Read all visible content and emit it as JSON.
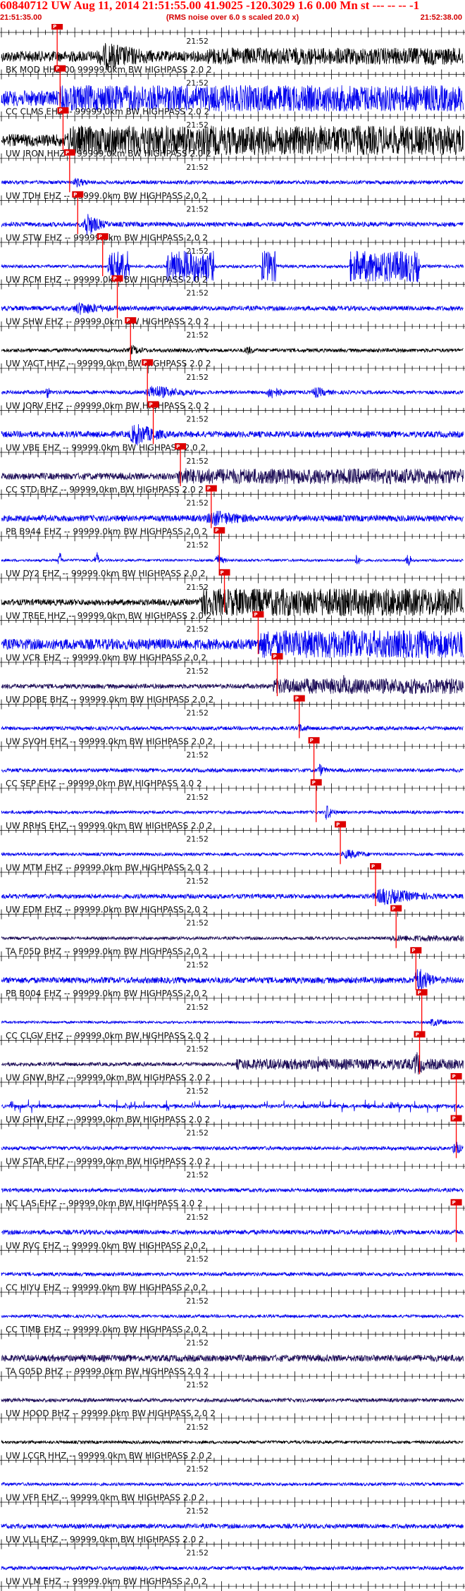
{
  "header": {
    "title": "60840712 UW Aug 11, 2014 21:51:55.00   41.9025 -120.3029  1.6 0.00 Mn st --- -- --  -1",
    "start_time": "21:51:35.00",
    "note": "(RMS noise over 6.0 s scaled 20.0 x)",
    "end_time": "21:52:38.00"
  },
  "colors": {
    "title": "#ff0000",
    "black": "#000000",
    "blue": "#0000ee",
    "navy": "#1a0a55",
    "pick": "#ff0000",
    "pick_box": "#dd0000"
  },
  "chart_data": {
    "type": "seismogram record section",
    "x_unit": "seconds after 21:51:35.00",
    "xlim": [
      0,
      63
    ],
    "minute_label": "21:52",
    "minute_label_time": 25,
    "tick_every_s": 1,
    "major_tick_every_s": 5,
    "traces": [
      {
        "label": "BK MOD HHZ 00 99999.0km BW  HIGHPASS  2.0  2",
        "color": "black",
        "pick": 7.6,
        "level": 0.35,
        "events": [
          [
            12,
            28,
            0.95,
            "burst"
          ],
          [
            28,
            63,
            0.55,
            "noise"
          ]
        ]
      },
      {
        "label": "CC CLMS EHZ -- 99999.0km BW  HIGHPASS  2.0  2",
        "color": "blue",
        "pick": 8.0,
        "level": 0.5,
        "events": [
          [
            8,
            63,
            0.85,
            "saturated"
          ]
        ]
      },
      {
        "label": "UW IRON HHZ -- 99999.0km BW  HIGHPASS  2.0  2",
        "color": "black",
        "pick": 8.4,
        "level": 0.4,
        "events": [
          [
            9,
            63,
            0.95,
            "saturated"
          ]
        ]
      },
      {
        "label": "UW TDH EHZ -- 99999.0km BW  HIGHPASS  2.0  2",
        "color": "blue",
        "pick": 9.3,
        "level": 0.12,
        "events": [
          [
            9.5,
            14,
            0.35,
            "burst"
          ]
        ]
      },
      {
        "label": "UW STW EHZ -- 99999.0km BW  HIGHPASS  2.0  2",
        "color": "blue",
        "pick": 10.4,
        "level": 0.15,
        "events": [
          [
            11,
            15,
            0.9,
            "burst"
          ]
        ]
      },
      {
        "label": "UW RCM EHZ -- 99999.0km BW  HIGHPASS  2.0  2",
        "color": "blue",
        "pick": 13.8,
        "level": 0.1,
        "events": [
          [
            14.5,
            17.5,
            1.0,
            "clip"
          ],
          [
            22.5,
            29,
            1.0,
            "clip"
          ],
          [
            35.5,
            37.5,
            1.0,
            "clip"
          ],
          [
            47.5,
            57,
            1.0,
            "clip"
          ]
        ]
      },
      {
        "label": "UW SHW EHZ -- 99999.0km BW  HIGHPASS  2.0  2",
        "color": "blue",
        "pick": 15.8,
        "level": 0.15,
        "events": [
          [
            9,
            20,
            0.45,
            "burst"
          ]
        ]
      },
      {
        "label": "UW YACT HHZ -- 99999.0km BW  HIGHPASS  2.0  2",
        "color": "black",
        "pick": 17.6,
        "level": 0.12,
        "events": [
          [
            17,
            22,
            0.35,
            "burst"
          ],
          [
            33,
            36,
            0.35,
            "burst"
          ]
        ]
      },
      {
        "label": "UW JORV EHZ -- 99999.0km BW  HIGHPASS  2.0  2",
        "color": "blue",
        "pick": 19.9,
        "level": 0.12,
        "events": [
          [
            6,
            7,
            0.6,
            "burst"
          ],
          [
            19,
            30,
            0.5,
            "burst"
          ],
          [
            36,
            40,
            0.5,
            "burst"
          ],
          [
            42,
            47,
            0.4,
            "burst"
          ]
        ]
      },
      {
        "label": "UW VBE EHZ -- 99999.0km BW  HIGHPASS  2.0  2",
        "color": "blue",
        "pick": 20.7,
        "level": 0.2,
        "events": [
          [
            17,
            25,
            0.8,
            "burst"
          ]
        ]
      },
      {
        "label": "CC STD BHZ -- 99999.0km BW  HIGHPASS  2.0  2",
        "color": "navy",
        "pick": 24.4,
        "level": 0.22,
        "events": [
          [
            24,
            63,
            0.5,
            "noise"
          ],
          [
            25,
            26,
            0.95,
            "burst"
          ]
        ]
      },
      {
        "label": "PB B944 EHZ -- 99999.0km BW  HIGHPASS  2.0  2",
        "color": "blue",
        "pick": 28.6,
        "level": 0.2,
        "events": [
          [
            27,
            40,
            0.55,
            "burst"
          ]
        ]
      },
      {
        "label": "UW DY2 EHZ -- 99999.0km BW  HIGHPASS  2.0  2",
        "color": "blue",
        "pick": 29.7,
        "level": 0.08,
        "events": [
          [
            7.5,
            8.5,
            0.6,
            "spike"
          ],
          [
            12.5,
            13.5,
            0.6,
            "spike"
          ],
          [
            29,
            31,
            0.5,
            "burst"
          ],
          [
            48,
            49,
            0.5,
            "spike"
          ],
          [
            55,
            56,
            0.6,
            "spike"
          ]
        ]
      },
      {
        "label": "UW TREE HHZ -- 99999.0km BW  HIGHPASS  2.0  2",
        "color": "black",
        "pick": 30.4,
        "level": 0.2,
        "events": [
          [
            27,
            63,
            0.9,
            "saturated"
          ]
        ]
      },
      {
        "label": "UW VCR EHZ -- 99999.0km BW  HIGHPASS  2.0  2",
        "color": "blue",
        "pick": 35.0,
        "level": 0.35,
        "events": [
          [
            35,
            63,
            0.9,
            "saturated"
          ]
        ]
      },
      {
        "label": "UW DOBE BHZ -- 99999.0km BW  HIGHPASS  2.0  2",
        "color": "navy",
        "pick": 37.6,
        "level": 0.15,
        "events": [
          [
            37,
            63,
            0.5,
            "noise"
          ],
          [
            46.5,
            47.5,
            0.9,
            "burst"
          ]
        ]
      },
      {
        "label": "UW SVOH EHZ -- 99999.0km BW  HIGHPASS  2.0  2",
        "color": "blue",
        "pick": 40.6,
        "level": 0.12,
        "events": [
          [
            40,
            44,
            0.3,
            "burst"
          ]
        ]
      },
      {
        "label": "CC SEP EHZ -- 99999.0km BW  HIGHPASS  2.0  2",
        "color": "blue",
        "pick": 42.6,
        "level": 0.12,
        "events": [
          [
            43,
            45,
            0.5,
            "burst"
          ]
        ]
      },
      {
        "label": "UW RRHS EHZ -- 99999.0km BW  HIGHPASS  2.0  2",
        "color": "blue",
        "pick": 42.9,
        "level": 0.1,
        "events": [
          [
            44,
            46,
            0.6,
            "burst"
          ]
        ]
      },
      {
        "label": "UW MTM EHZ -- 99999.0km BW  HIGHPASS  2.0  2",
        "color": "blue",
        "pick": 46.2,
        "level": 0.1,
        "events": [
          [
            46,
            53,
            0.35,
            "burst"
          ]
        ]
      },
      {
        "label": "UW EDM EHZ -- 99999.0km BW  HIGHPASS  2.0  2",
        "color": "blue",
        "pick": 51.0,
        "level": 0.15,
        "events": [
          [
            50,
            63,
            0.6,
            "burst"
          ]
        ]
      },
      {
        "label": "TA F05D BHZ -- 99999.0km BW  HIGHPASS  2.0  2",
        "color": "navy",
        "pick": 53.8,
        "level": 0.1,
        "events": [
          [
            53,
            63,
            0.2,
            "noise"
          ]
        ]
      },
      {
        "label": "PB B004 EHZ -- 99999.0km BW  HIGHPASS  2.0  2",
        "color": "blue",
        "pick": 56.5,
        "level": 0.2,
        "events": [
          [
            56,
            61,
            0.9,
            "burst"
          ]
        ]
      },
      {
        "label": "CC CLGV EHZ -- 99999.0km BW  HIGHPASS  2.0  2",
        "color": "blue",
        "pick": 57.3,
        "level": 0.08,
        "events": [
          [
            58,
            63,
            0.3,
            "burst"
          ]
        ]
      },
      {
        "label": "UW GNW BHZ -- 99999.0km BW  HIGHPASS  2.0  2",
        "color": "navy",
        "pick": 57.0,
        "level": 0.12,
        "events": [
          [
            32,
            63,
            0.35,
            "noise"
          ],
          [
            43,
            44,
            0.6,
            "burst"
          ],
          [
            56,
            59,
            0.95,
            "burst"
          ]
        ]
      },
      {
        "label": "UW GHW EHZ -- 99999.0km BW  HIGHPASS  2.0  2",
        "color": "blue",
        "pick": 62.0,
        "level": 0.12,
        "events": [
          [
            0,
            63,
            0.45,
            "spikes"
          ]
        ]
      },
      {
        "label": "UW STAR EHZ -- 99999.0km BW  HIGHPASS  2.0  2",
        "color": "blue",
        "pick": 62.0,
        "level": 0.12,
        "events": [
          [
            61.5,
            63,
            0.8,
            "burst"
          ]
        ]
      },
      {
        "label": "NC LAS EHZ -- 99999.0km BW  HIGHPASS  2.0  2",
        "color": "blue",
        "pick": null,
        "level": 0.12,
        "events": []
      },
      {
        "label": "UW RVC EHZ -- 99999.0km BW  HIGHPASS  2.0  2",
        "color": "blue",
        "pick": 62.0,
        "level": 0.15,
        "events": []
      },
      {
        "label": "CC HIYU EHZ -- 99999.0km BW  HIGHPASS  2.0  2",
        "color": "blue",
        "pick": null,
        "level": 0.12,
        "events": []
      },
      {
        "label": "CC TIMB EHZ -- 99999.0km BW  HIGHPASS  2.0  2",
        "color": "blue",
        "pick": null,
        "level": 0.1,
        "events": []
      },
      {
        "label": "TA G05D BHZ -- 99999.0km BW  HIGHPASS  2.0  2",
        "color": "navy",
        "pick": null,
        "level": 0.22,
        "events": []
      },
      {
        "label": "UW HOOD BHZ -- 99999.0km BW  HIGHPASS  2.0  2",
        "color": "navy",
        "pick": null,
        "level": 0.12,
        "events": []
      },
      {
        "label": "UW LCCR HHZ -- 99999.0km BW  HIGHPASS  2.0  2",
        "color": "black",
        "pick": null,
        "level": 0.1,
        "events": []
      },
      {
        "label": "UW VFP EHZ -- 99999.0km BW  HIGHPASS  2.0  2",
        "color": "blue",
        "pick": null,
        "level": 0.1,
        "events": []
      },
      {
        "label": "UW VLL EHZ -- 99999.0km BW  HIGHPASS  2.0  2",
        "color": "blue",
        "pick": null,
        "level": 0.15,
        "events": []
      },
      {
        "label": "UW VLM EHZ -- 99999.0km BW  HIGHPASS  2.0  2",
        "color": "blue",
        "pick": null,
        "level": 0.12,
        "events": []
      },
      {
        "label": "",
        "color": "blue",
        "pick": null,
        "level": 0.18,
        "events": []
      }
    ]
  }
}
